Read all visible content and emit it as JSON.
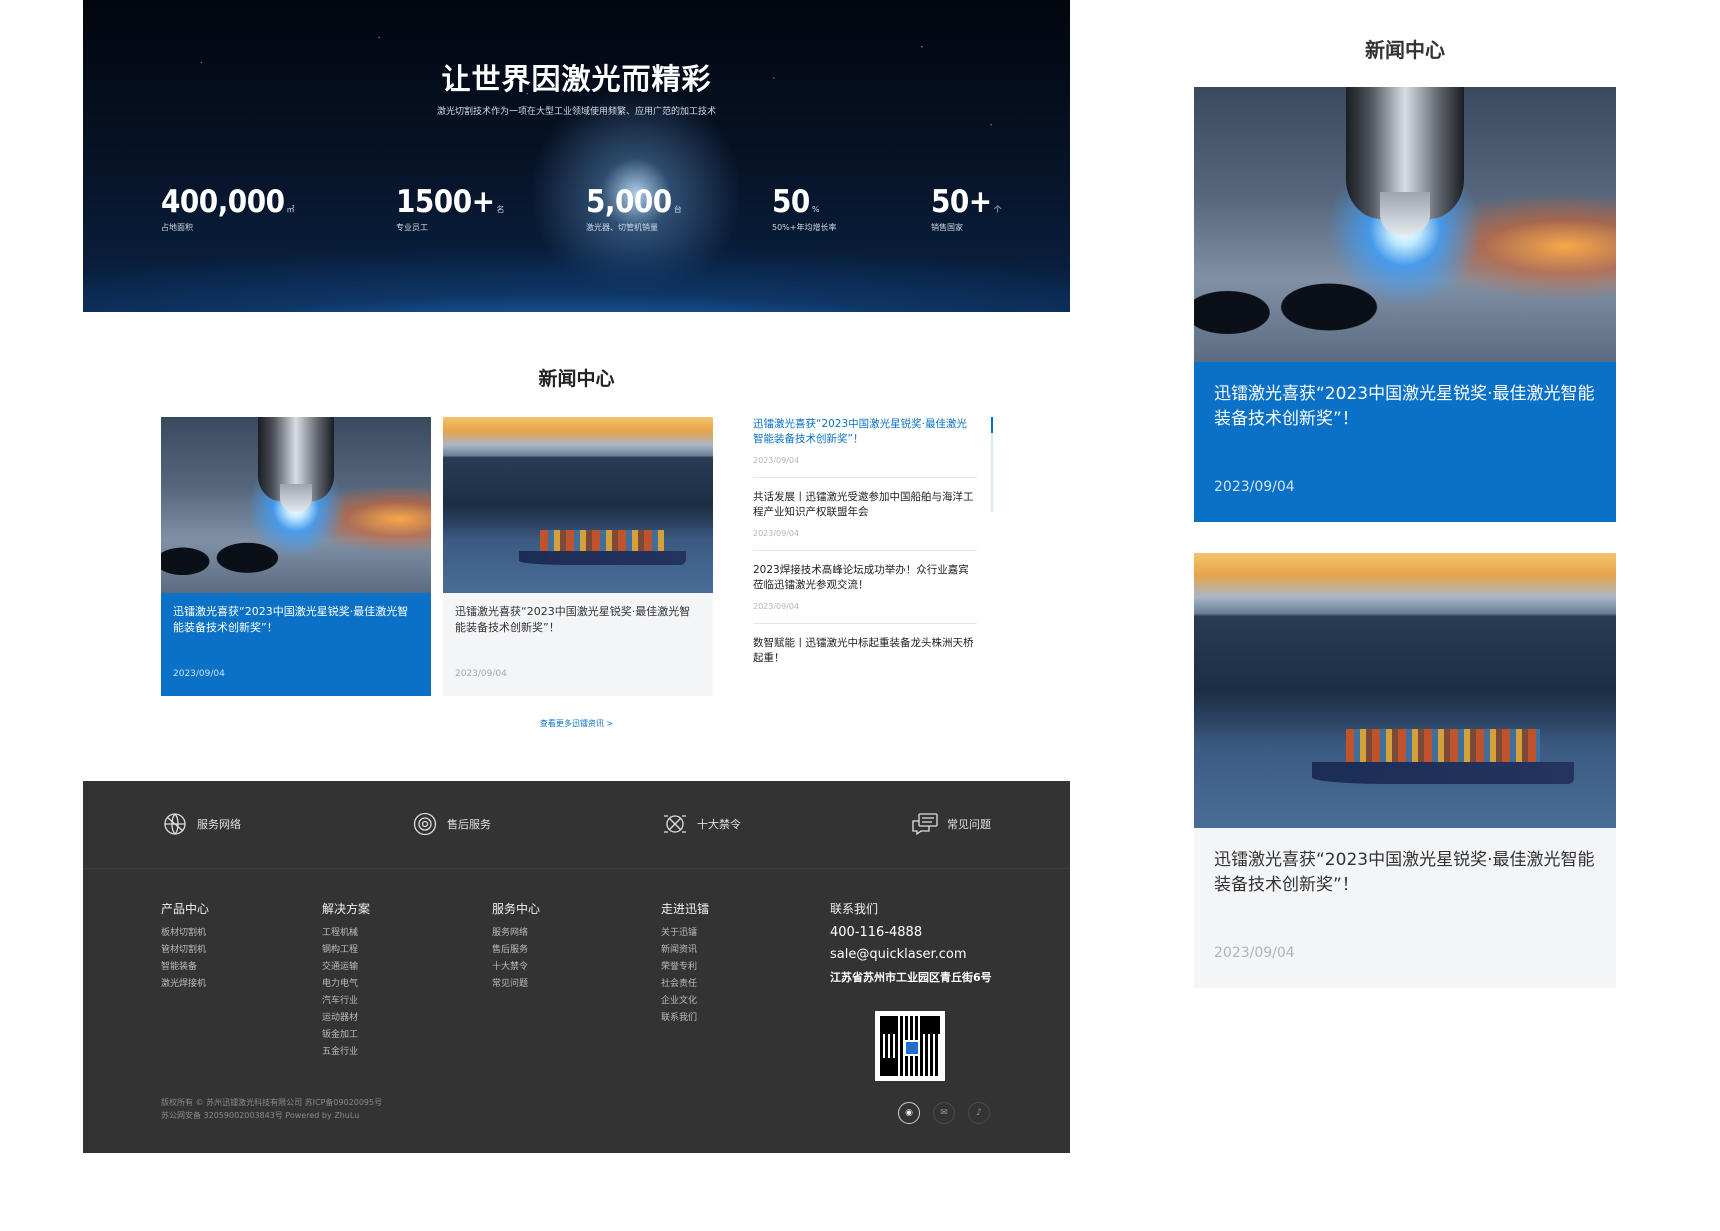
{
  "hero": {
    "title": "让世界因激光而精彩",
    "subtitle": "激光切割技术作为一项在大型工业领域使用频繁、应用广范的加工技术",
    "stats": [
      {
        "value": "400,000",
        "unit": "㎡",
        "label": "占地面积"
      },
      {
        "value": "1500+",
        "unit": "名",
        "label": "专业员工"
      },
      {
        "value": "5,000",
        "unit": "台",
        "label": "激光器、切管机销量"
      },
      {
        "value": "50",
        "unit": "%",
        "label": "50%+年均增长率"
      },
      {
        "value": "50+",
        "unit": "个",
        "label": "销售国家"
      }
    ]
  },
  "news": {
    "title": "新闻中心",
    "cards": [
      {
        "title": "迅镭激光喜获“2023中国激光星锐奖·最佳激光智能装备技术创新奖”！",
        "date": "2023/09/04"
      },
      {
        "title": "迅镭激光喜获“2023中国激光星锐奖·最佳激光智能装备技术创新奖”！",
        "date": "2023/09/04"
      }
    ],
    "list": [
      {
        "title": "迅镭激光喜获“2023中国激光星锐奖·最佳激光智能装备技术创新奖”！",
        "date": "2023/09/04"
      },
      {
        "title": "共话发展丨迅镭激光受邀参加中国船舶与海洋工程产业知识产权联盟年会",
        "date": "2023/09/04"
      },
      {
        "title": "2023焊接技术高峰论坛成功举办！众行业嘉宾莅临迅镭激光参观交流！",
        "date": "2023/09/04"
      },
      {
        "title": "数智赋能丨迅镭激光中标起重装备龙头株洲天桥起重！",
        "date": ""
      }
    ],
    "more": "查看更多迅镭资讯 >"
  },
  "footer": {
    "services": [
      {
        "label": "服务网络",
        "icon": "globe-icon"
      },
      {
        "label": "售后服务",
        "icon": "gear-icon"
      },
      {
        "label": "十大禁令",
        "icon": "prohibition-icon"
      },
      {
        "label": "常见问题",
        "icon": "chat-icon"
      }
    ],
    "columns": [
      {
        "heading": "产品中心",
        "items": [
          "板材切割机",
          "管材切割机",
          "智能装备",
          "激光焊接机"
        ]
      },
      {
        "heading": "解决方案",
        "items": [
          "工程机械",
          "钢构工程",
          "交通运输",
          "电力电气",
          "汽车行业",
          "运动器材",
          "钣金加工",
          "五金行业"
        ]
      },
      {
        "heading": "服务中心",
        "items": [
          "服务网络",
          "售后服务",
          "十大禁令",
          "常见问题"
        ]
      },
      {
        "heading": "走进迅镭",
        "items": [
          "关于迅镭",
          "新闻资讯",
          "荣誉专利",
          "社会责任",
          "企业文化",
          "联系我们"
        ]
      }
    ],
    "contact": {
      "heading": "联系我们",
      "phone": "400-116-4888",
      "email": "sale@quicklaser.com",
      "address": "江苏省苏州市工业园区青丘街6号"
    },
    "copyright": {
      "line1": "版权所有 © 苏州迅镭激光科技有限公司    苏ICP备09020095号",
      "line2": "苏公网安备 32059002003843号 Powered by ZhuLu"
    },
    "social": [
      {
        "icon": "wechat-icon",
        "glyph": "◉"
      },
      {
        "icon": "mail-icon",
        "glyph": "✉"
      },
      {
        "icon": "tiktok-icon",
        "glyph": "♪"
      }
    ]
  },
  "mobile": {
    "title": "新闻中心",
    "cards": [
      {
        "title": "迅镭激光喜获“2023中国激光星锐奖·最佳激光智能装备技术创新奖”！",
        "date": "2023/09/04"
      },
      {
        "title": "迅镭激光喜获“2023中国激光星锐奖·最佳激光智能装备技术创新奖”！",
        "date": "2023/09/04"
      }
    ]
  },
  "colors": {
    "accent": "#0a71c7",
    "footer_bg": "#333333",
    "card_grey": "#f4f5f7"
  }
}
